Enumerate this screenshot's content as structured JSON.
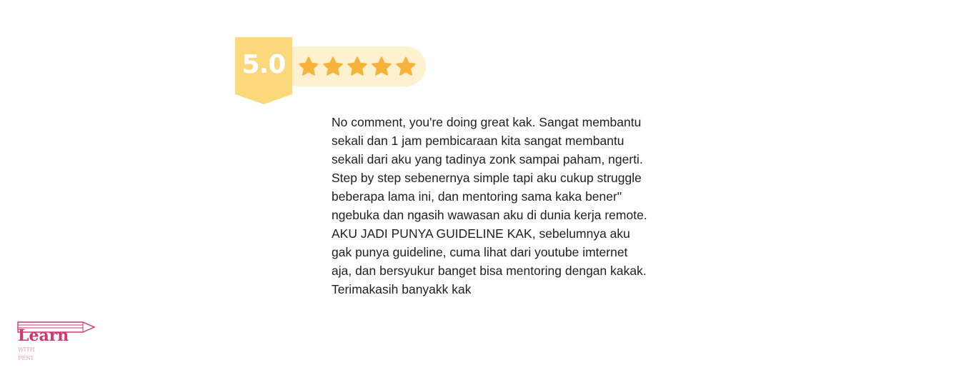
{
  "rating": {
    "score": "5.0",
    "stars": 5,
    "colors": {
      "ribbon": "#fbd97a",
      "ribbon_fold": "#e0a53a",
      "pill": "#fdf1cf",
      "star": "#f6b23a",
      "score_text": "#ffffff"
    }
  },
  "review": {
    "text": "No comment, you're doing great kak. Sangat membantu sekali dan 1 jam pembicaraan kita sangat membantu sekali dari aku yang tadinya zonk sampai paham, ngerti. Step by step sebenernya simple tapi aku cukup struggle beberapa lama ini, dan mentoring sama kaka bener\" ngebuka dan ngasih wawasan aku di dunia kerja remote. AKU JADI PUNYA GUIDELINE KAK, sebelumnya aku gak punya guideline, cuma lihat dari youtube imternet aja, dan bersyukur banget bisa mentoring dengan kakak. Terimakasih banyakk kak"
  },
  "logo": {
    "main": "Learn",
    "line2": "WITH",
    "line3": "PENI",
    "colors": {
      "main": "#c93a72",
      "sub": "#e89bbb"
    },
    "icon": "pencil-icon"
  }
}
